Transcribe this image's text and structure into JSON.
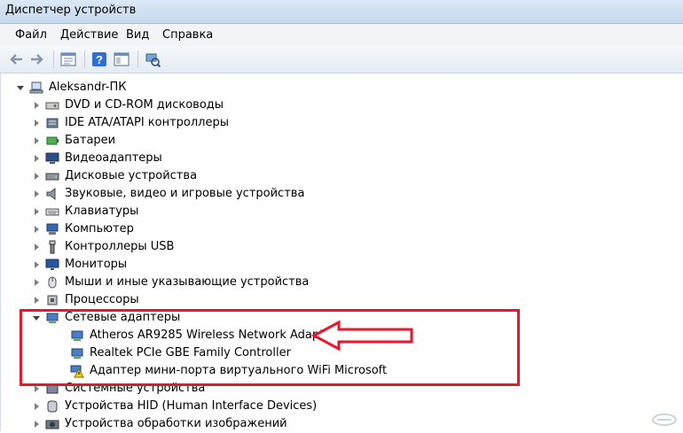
{
  "window": {
    "title": "Диспетчер устройств"
  },
  "menu": [
    "Файл",
    "Действие",
    "Вид",
    "Справка"
  ],
  "toolbar": [
    "back-icon",
    "forward-icon",
    "properties-icon",
    "help-icon",
    "show-hide-icon",
    "scan-hardware-icon"
  ],
  "tree": {
    "root": "Aleksandr-ПК",
    "categories": [
      {
        "label": "DVD и CD-ROM дисководы",
        "icon": "dvd-drive-icon"
      },
      {
        "label": "IDE ATA/ATAPI контроллеры",
        "icon": "ide-controller-icon"
      },
      {
        "label": "Батареи",
        "icon": "battery-icon"
      },
      {
        "label": "Видеоадаптеры",
        "icon": "display-adapter-icon"
      },
      {
        "label": "Дисковые устройства",
        "icon": "disk-drive-icon"
      },
      {
        "label": "Звуковые, видео и игровые устройства",
        "icon": "speaker-icon"
      },
      {
        "label": "Клавиатуры",
        "icon": "keyboard-icon"
      },
      {
        "label": "Компьютер",
        "icon": "computer-icon"
      },
      {
        "label": "Контроллеры USB",
        "icon": "usb-icon"
      },
      {
        "label": "Мониторы",
        "icon": "monitor-icon"
      },
      {
        "label": "Мыши и иные указывающие устройства",
        "icon": "mouse-icon"
      },
      {
        "label": "Процессоры",
        "icon": "cpu-icon"
      }
    ],
    "network": {
      "label": "Сетевые адаптеры",
      "children": [
        {
          "label": "Atheros AR9285 Wireless Network Adapter",
          "warning": false
        },
        {
          "label": "Realtek PCIe GBE Family Controller",
          "warning": false
        },
        {
          "label": "Адаптер мини-порта виртуального WiFi Microsoft",
          "warning": true
        }
      ]
    },
    "after": [
      {
        "label": "Системные устройства",
        "icon": "system-device-icon"
      },
      {
        "label": "Устройства HID (Human Interface Devices)",
        "icon": "hid-icon"
      },
      {
        "label": "Устройства обработки изображений",
        "icon": "camera-icon"
      }
    ]
  },
  "colors": {
    "highlight": "#e8172a",
    "callout_fill": "#ffffff"
  }
}
